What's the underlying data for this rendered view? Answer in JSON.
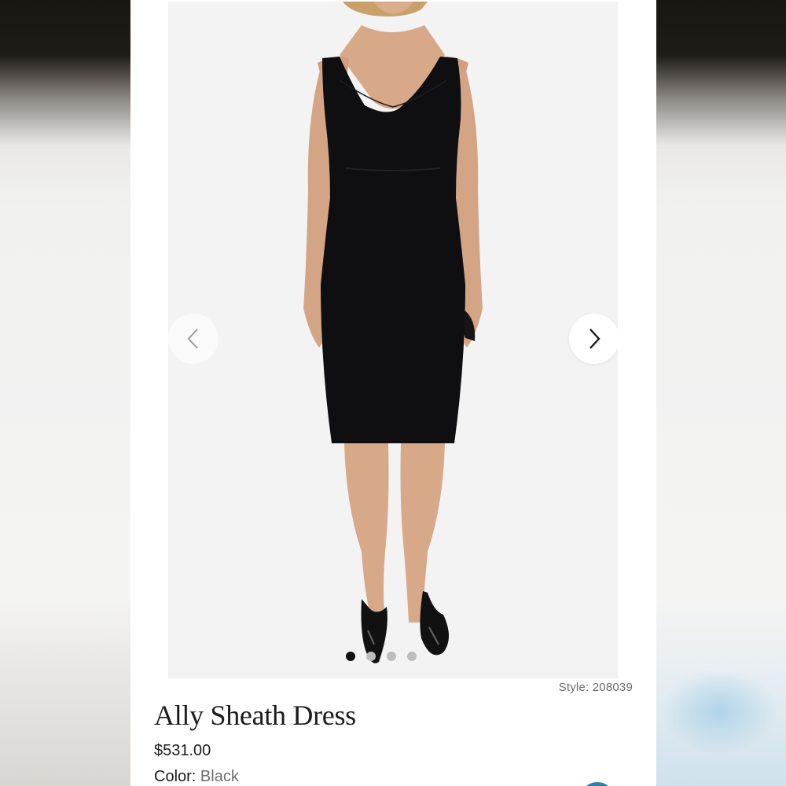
{
  "product": {
    "style_label": "Style: 208039",
    "title": "Ally Sheath Dress",
    "price": "$531.00",
    "color_label": "Color:",
    "color_value": "Black"
  },
  "gallery": {
    "slide_count": 4,
    "active_slide": 1,
    "prev_icon": "chevron-left-icon",
    "next_icon": "chevron-right-icon"
  },
  "colors": {
    "dress": "#0f0f12",
    "skin": "#d7a989",
    "gallery_bg": "#f3f3f3",
    "dot_active": "#111111",
    "dot_inactive": "#bdbdbd"
  }
}
